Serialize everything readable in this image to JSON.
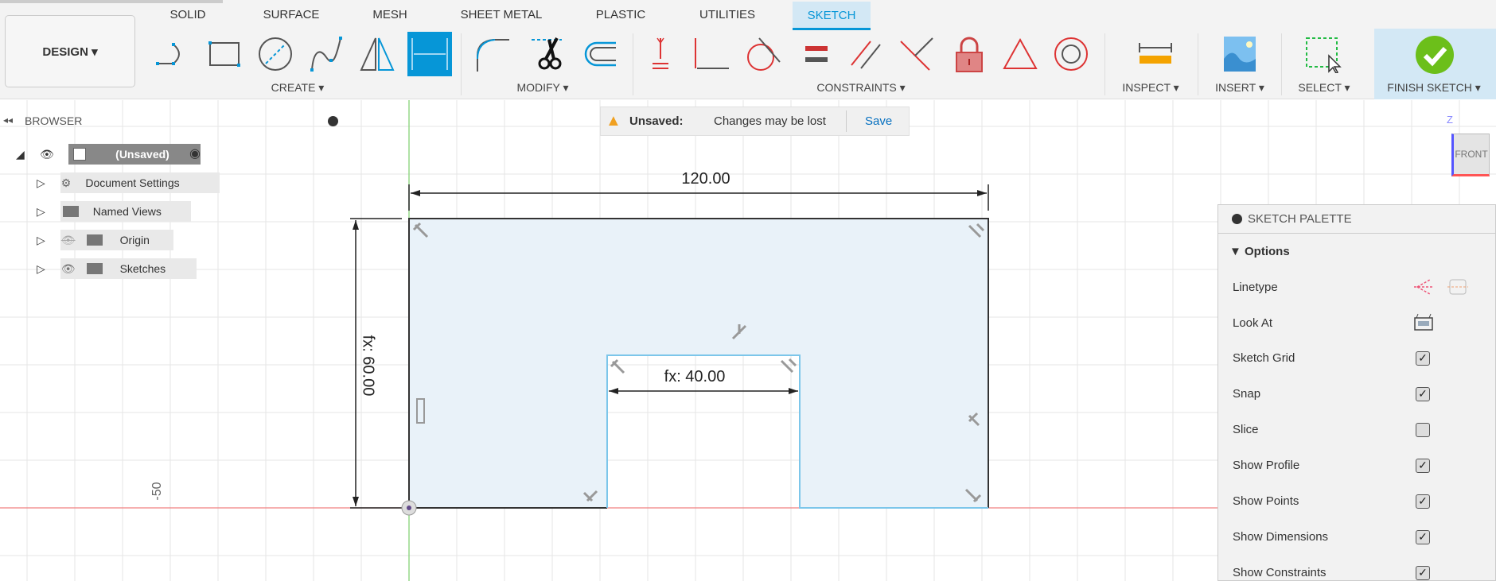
{
  "toolbar": {
    "workspace": "DESIGN",
    "tabs": [
      {
        "label": "SOLID"
      },
      {
        "label": "SURFACE"
      },
      {
        "label": "MESH"
      },
      {
        "label": "SHEET METAL"
      },
      {
        "label": "PLASTIC"
      },
      {
        "label": "UTILITIES"
      },
      {
        "label": "SKETCH",
        "active": true
      }
    ],
    "groups": {
      "create": "CREATE",
      "modify": "MODIFY",
      "constraints": "CONSTRAINTS",
      "inspect": "INSPECT",
      "insert": "INSERT",
      "select": "SELECT",
      "finish": "FINISH SKETCH"
    },
    "accent": "#0696d7"
  },
  "browser": {
    "title": "BROWSER",
    "root": "(Unsaved)",
    "items": [
      {
        "label": "Document Settings"
      },
      {
        "label": "Named Views"
      },
      {
        "label": "Origin"
      },
      {
        "label": "Sketches"
      }
    ]
  },
  "notice": {
    "status": "Unsaved:",
    "message": "Changes may be lost",
    "action": "Save"
  },
  "viewcube": {
    "face": "FRONT",
    "axis": "Z"
  },
  "sketch": {
    "dims": {
      "width": "120.00",
      "height": "fx: 60.00",
      "notch": "fx: 40.00"
    },
    "axis_label": "-50"
  },
  "palette": {
    "title": "SKETCH PALETTE",
    "section": "Options",
    "linetype": "Linetype",
    "look_at": "Look At",
    "options": [
      {
        "label": "Sketch Grid",
        "checked": true
      },
      {
        "label": "Snap",
        "checked": true
      },
      {
        "label": "Slice",
        "checked": false
      },
      {
        "label": "Show Profile",
        "checked": true
      },
      {
        "label": "Show Points",
        "checked": true
      },
      {
        "label": "Show Dimensions",
        "checked": true
      },
      {
        "label": "Show Constraints",
        "checked": true
      }
    ]
  }
}
